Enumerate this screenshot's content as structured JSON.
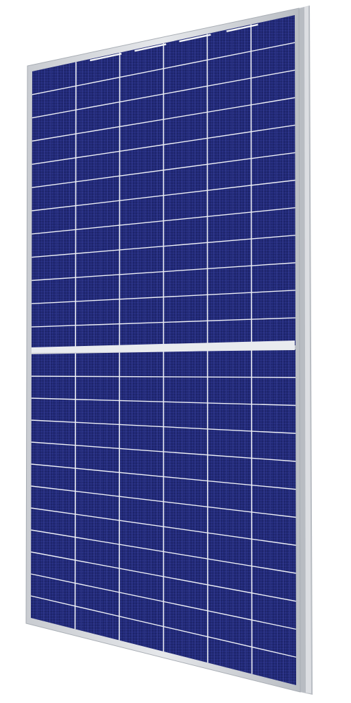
{
  "image": {
    "subject": "solar-panel",
    "background_color": "#ffffff",
    "frame_color": "#d6d8dc",
    "frame_edge_color": "#aeb2b8",
    "cell_color": "#232a78",
    "cell_shadow_color": "#1a1f5e",
    "grid_line_color": "#eef0f6",
    "busbar_color": "#3a429a",
    "panel": {
      "cell_columns": 6,
      "cell_rows_per_half": 12,
      "halves": 2
    }
  }
}
